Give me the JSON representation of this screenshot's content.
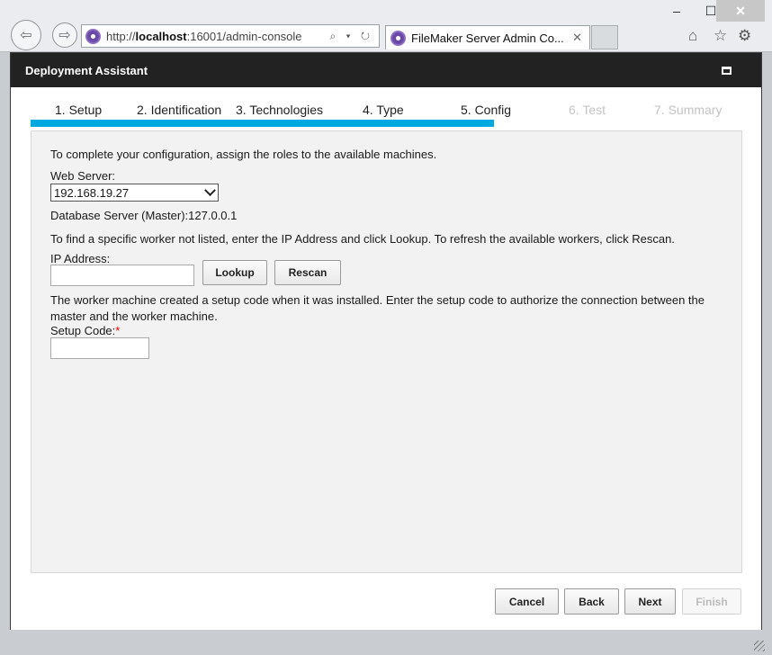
{
  "browser": {
    "window_controls": {
      "minimize": "–",
      "maximize": "☐",
      "close": "✕"
    },
    "address": {
      "prefix": "http://",
      "host": "localhost",
      "rest": ":16001/admin-console",
      "tools": "⌕ ▾ ↻"
    },
    "tab": {
      "title": "FileMaker Server Admin Co...",
      "close": "✕"
    },
    "icons": [
      "back-icon",
      "forward-icon",
      "home-icon",
      "star-icon",
      "gear-icon"
    ]
  },
  "dialog": {
    "title": "Deployment Assistant",
    "steps": [
      {
        "label": "1. Setup",
        "state": "done"
      },
      {
        "label": "2. Identification",
        "state": "done"
      },
      {
        "label": "3. Technologies",
        "state": "done"
      },
      {
        "label": "4. Type",
        "state": "done"
      },
      {
        "label": "5. Config",
        "state": "current"
      },
      {
        "label": "6. Test",
        "state": "disabled"
      },
      {
        "label": "7. Summary",
        "state": "disabled"
      }
    ],
    "progress_fraction": 0.71,
    "accent_color": "#00a8e0",
    "config": {
      "intro": "To complete your configuration, assign the roles to the available machines.",
      "web_server_label": "Web Server:",
      "web_server_value": "192.168.19.27",
      "database_server": "Database Server (Master):127.0.0.1",
      "lookup_hint": "To find a specific worker not listed, enter the IP Address and click Lookup. To refresh the available workers, click Rescan.",
      "ip_label": "IP Address:",
      "ip_value": "",
      "lookup_button": "Lookup",
      "rescan_button": "Rescan",
      "setup_hint": "The worker machine created a setup code when it was installed. Enter the setup code to authorize the connection between the master and the worker machine.",
      "setup_code_label": "Setup Code:",
      "required_marker": "*",
      "setup_code_value": ""
    },
    "buttons": {
      "cancel": "Cancel",
      "back": "Back",
      "next": "Next",
      "finish": "Finish"
    }
  }
}
